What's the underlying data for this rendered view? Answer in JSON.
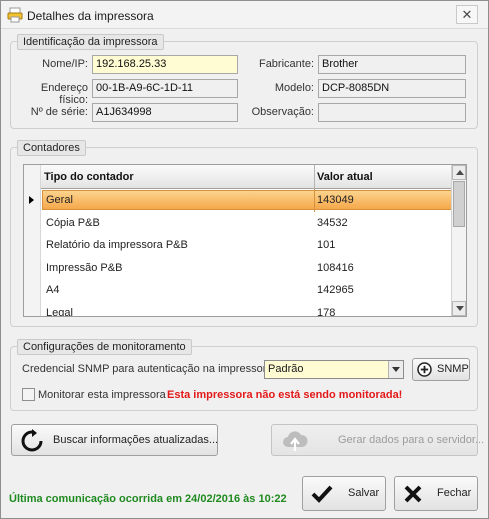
{
  "window": {
    "title": "Detalhes da impressora",
    "close_glyph": "✕"
  },
  "identification": {
    "legend": "Identificação da impressora",
    "name_label": "Nome/IP:",
    "name_value": "192.168.25.33",
    "mac_label": "Endereço físico:",
    "mac_value": "00-1B-A9-6C-1D-11",
    "serial_label": "Nº de série:",
    "serial_value": "A1J634998",
    "manufacturer_label": "Fabricante:",
    "manufacturer_value": "Brother",
    "model_label": "Modelo:",
    "model_value": "DCP-8085DN",
    "observation_label": "Observação:",
    "observation_value": ""
  },
  "counters": {
    "legend": "Contadores",
    "col_type": "Tipo do contador",
    "col_value": "Valor atual",
    "rows": [
      {
        "type": "Geral",
        "value": "143049"
      },
      {
        "type": "Cópia P&B",
        "value": "34532"
      },
      {
        "type": "Relatório da impressora P&B",
        "value": "101"
      },
      {
        "type": "Impressão P&B",
        "value": "108416"
      },
      {
        "type": "A4",
        "value": "142965"
      },
      {
        "type": "Legal",
        "value": "178"
      }
    ]
  },
  "monitoring": {
    "legend": "Configurações de monitoramento",
    "snmp_label": "Credencial SNMP para autenticação na impressora:",
    "snmp_value": "Padrão",
    "snmp_button": "SNMP",
    "monitor_label": "Monitorar esta impressora",
    "warning": "Esta impressora não está sendo monitorada!"
  },
  "actions": {
    "refresh": "Buscar informações atualizadas...",
    "server": "Gerar dados para o servidor...",
    "save": "Salvar",
    "close": "Fechar"
  },
  "status_text": "Última comunicação ocorrida em 24/02/2016 às 10:22",
  "colors": {
    "selection": "#f6a84a",
    "field_highlight": "#fffbd2",
    "warning": "#e31818",
    "status": "#1f8a1f"
  }
}
